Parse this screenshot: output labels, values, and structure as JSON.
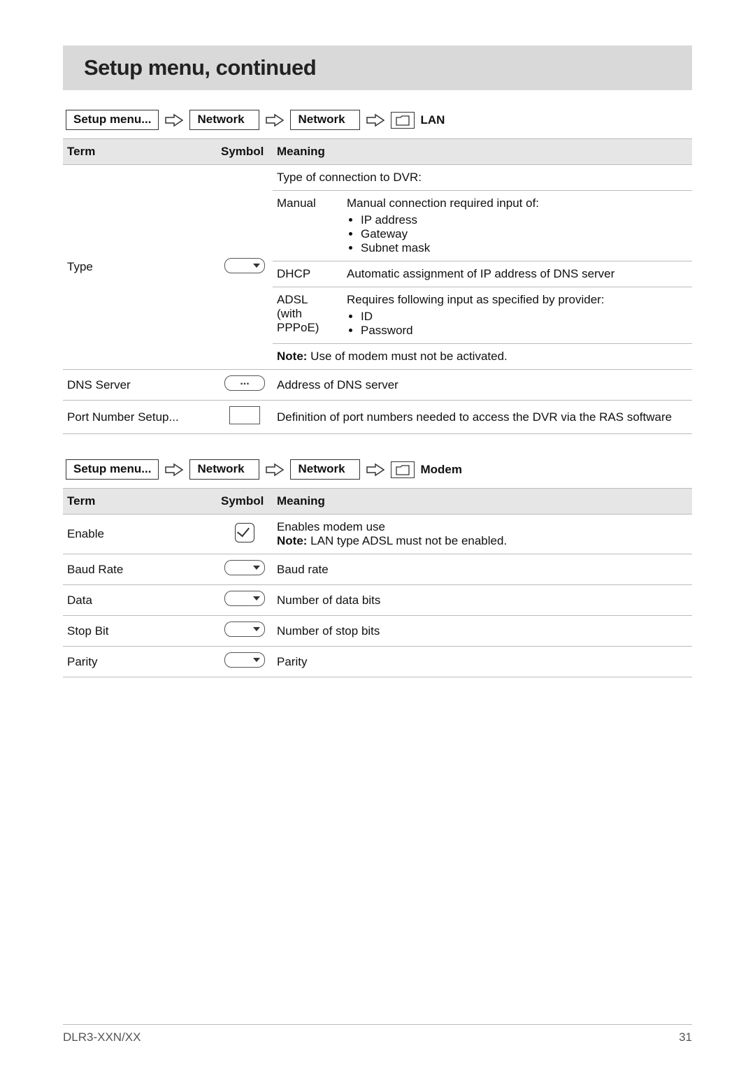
{
  "title": "Setup menu, continued",
  "breadcrumb1": {
    "items": [
      "Setup menu...",
      "Network",
      "Network"
    ],
    "leaf": "LAN"
  },
  "breadcrumb2": {
    "items": [
      "Setup menu...",
      "Network",
      "Network"
    ],
    "leaf": "Modem"
  },
  "headers": {
    "term": "Term",
    "symbol": "Symbol",
    "meaning": "Meaning"
  },
  "lan": {
    "type": {
      "term": "Type",
      "meaning_intro": "Type of connection to DVR:",
      "manual": {
        "label": "Manual",
        "text": "Manual connection required input of:",
        "items": [
          "IP address",
          "Gateway",
          "Subnet mask"
        ]
      },
      "dhcp": {
        "label": "DHCP",
        "text": "Automatic assignment of IP address of DNS server"
      },
      "adsl": {
        "label": "ADSL (with PPPoE)",
        "text": "Requires following input as specified by provider:",
        "items": [
          "ID",
          "Password"
        ]
      },
      "note_label": "Note:",
      "note_text": " Use of modem must not be activated."
    },
    "dns": {
      "term": "DNS Server",
      "meaning": "Address of DNS server"
    },
    "port": {
      "term": "Port Number Setup...",
      "meaning": "Definition of port numbers needed to access the DVR via the RAS software"
    }
  },
  "modem": {
    "enable": {
      "term": "Enable",
      "line1": "Enables modem use",
      "note_label": "Note:",
      "note_text": " LAN type ADSL must not be enabled."
    },
    "baud": {
      "term": "Baud Rate",
      "meaning": "Baud rate"
    },
    "data": {
      "term": "Data",
      "meaning": "Number of data bits"
    },
    "stop": {
      "term": "Stop Bit",
      "meaning": "Number of stop bits"
    },
    "parity": {
      "term": "Parity",
      "meaning": "Parity"
    }
  },
  "footer": {
    "left": "DLR3-XXN/XX",
    "right": "31"
  }
}
